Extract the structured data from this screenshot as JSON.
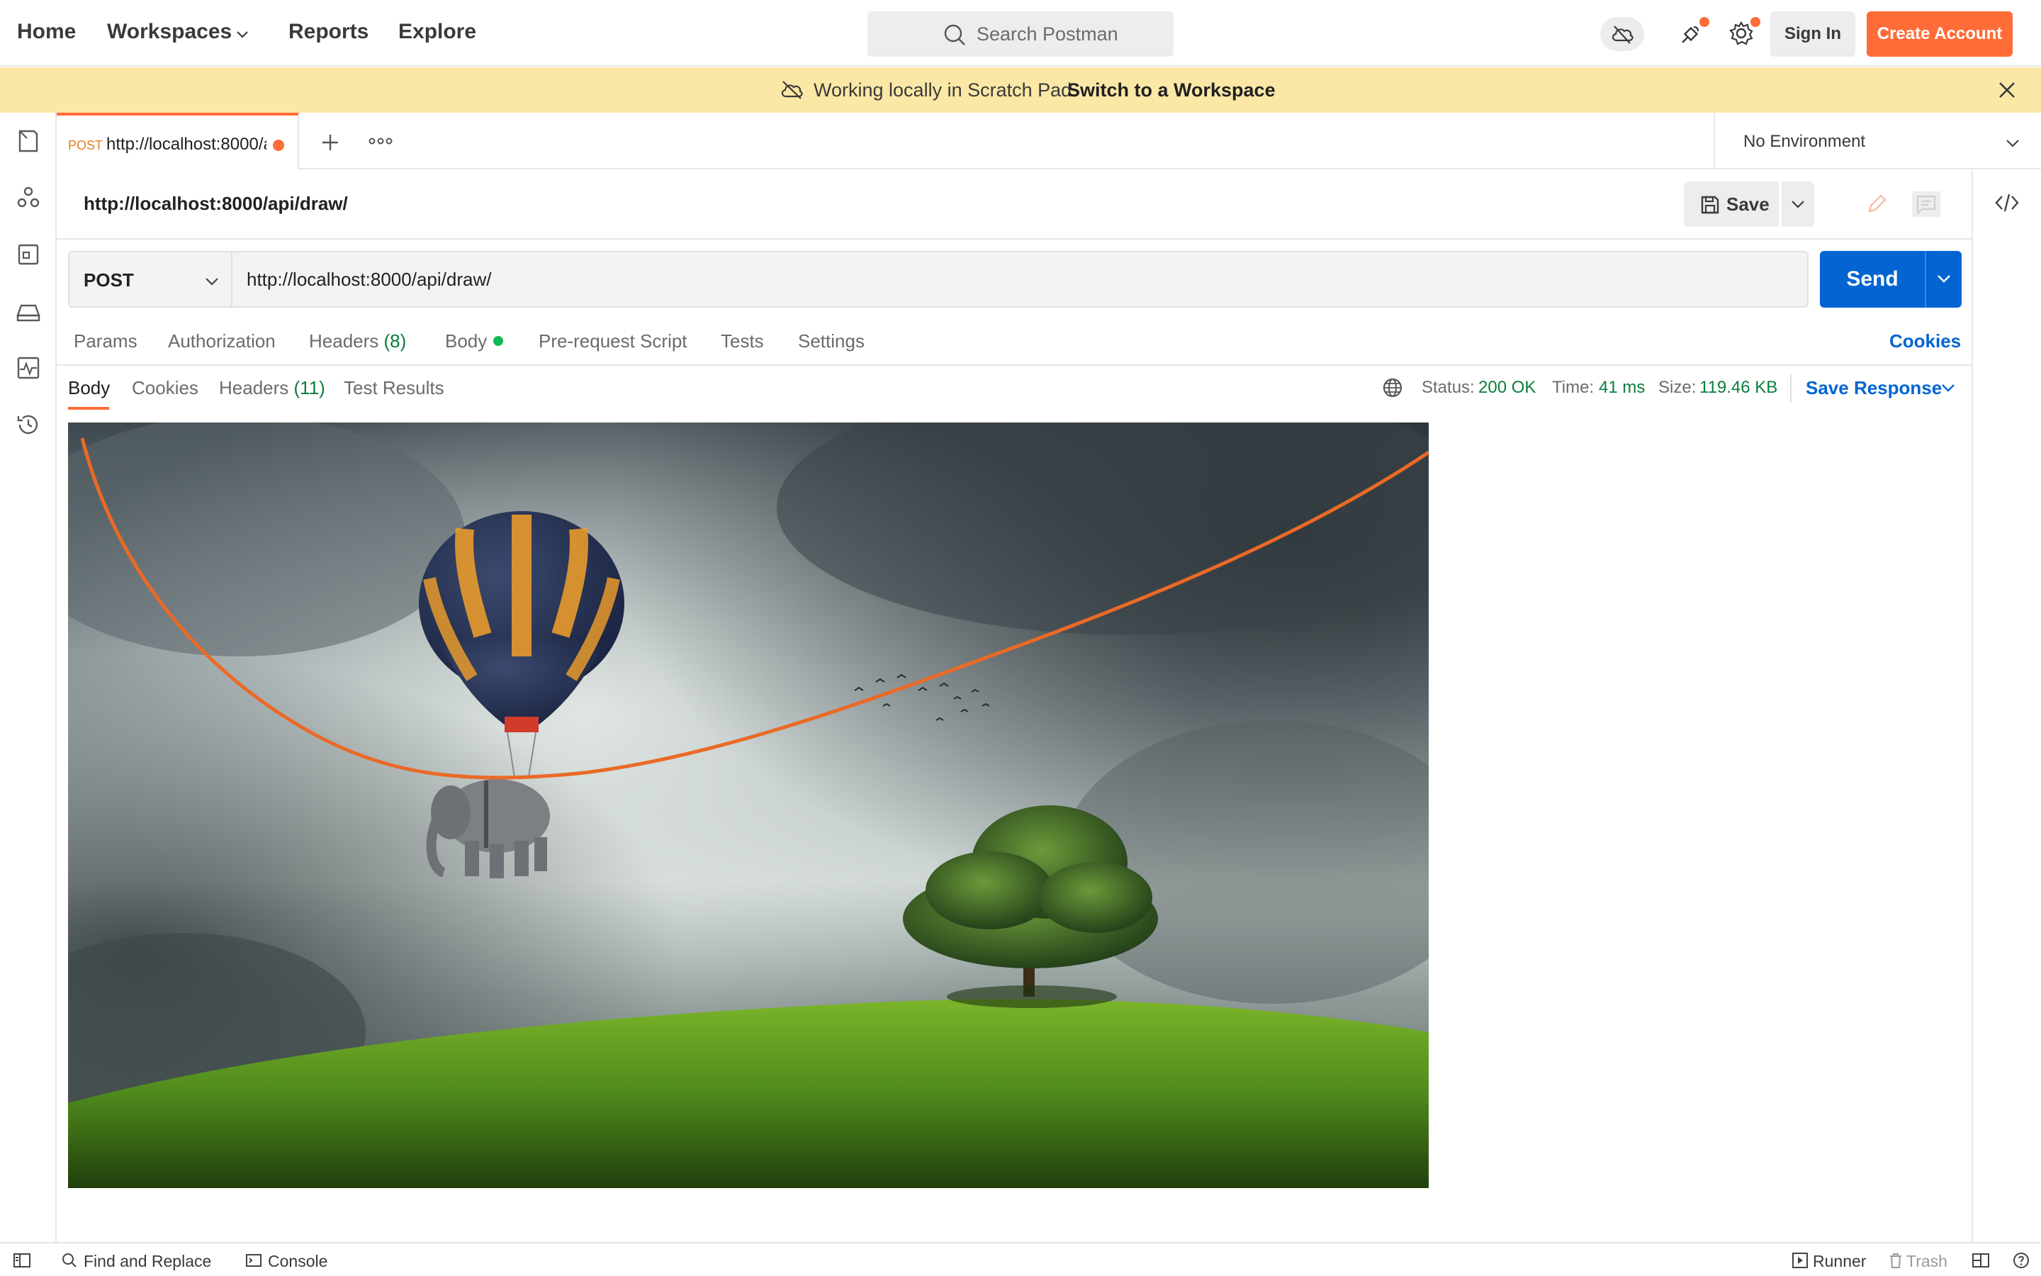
{
  "nav": {
    "home": "Home",
    "workspaces": "Workspaces",
    "reports": "Reports",
    "explore": "Explore",
    "search_placeholder": "Search Postman",
    "sign_in": "Sign In",
    "create_account": "Create Account"
  },
  "banner": {
    "text": "Working locally in Scratch Pad.",
    "link": "Switch to a Workspace"
  },
  "tab": {
    "method": "POST",
    "url": "http://localhost:8000/api/draw/"
  },
  "environment": {
    "selected": "No Environment"
  },
  "request": {
    "title": "http://localhost:8000/api/draw/",
    "save_label": "Save",
    "method": "POST",
    "url": "http://localhost:8000/api/draw/",
    "send_label": "Send"
  },
  "request_tabs": {
    "params": "Params",
    "authorization": "Authorization",
    "headers": "Headers",
    "headers_count": "(8)",
    "body": "Body",
    "pre_request": "Pre-request Script",
    "tests": "Tests",
    "settings": "Settings",
    "cookies": "Cookies"
  },
  "response": {
    "tabs": {
      "body": "Body",
      "cookies": "Cookies",
      "headers": "Headers",
      "headers_count": "(11)",
      "test_results": "Test Results"
    },
    "status_label": "Status:",
    "status_value": "200 OK",
    "time_label": "Time:",
    "time_value": "41 ms",
    "size_label": "Size:",
    "size_value": "119.46 KB",
    "save_response": "Save Response"
  },
  "footer": {
    "find_replace": "Find and Replace",
    "console": "Console",
    "runner": "Runner",
    "trash": "Trash"
  },
  "colors": {
    "accent": "#ff6c37",
    "primary": "#0265d2",
    "success": "#0a7c3e",
    "banner_bg": "#fbe8a6"
  }
}
